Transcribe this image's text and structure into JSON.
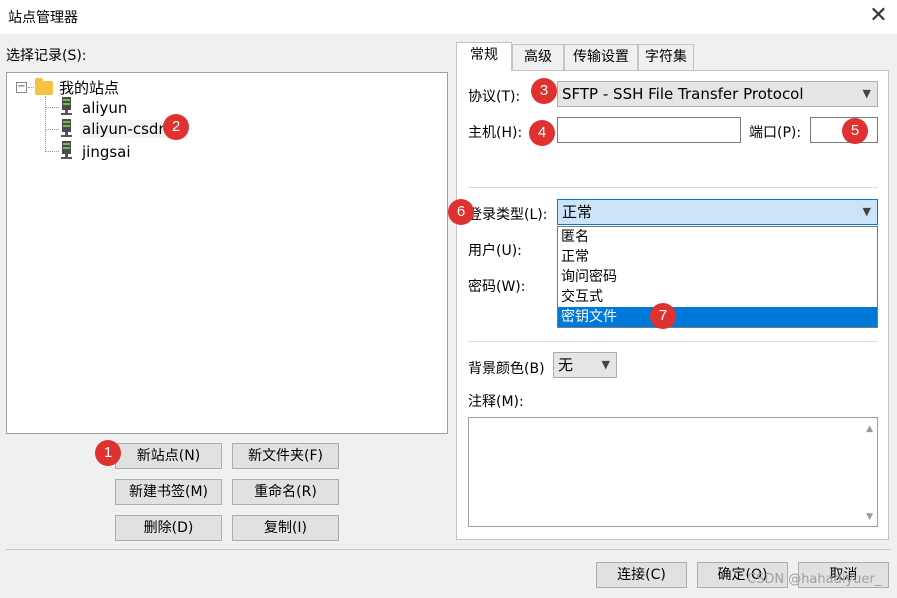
{
  "window": {
    "title": "站点管理器",
    "close_glyph": "✕"
  },
  "left": {
    "select_label": "选择记录(S):",
    "tree": {
      "root_label": "我的站点",
      "expander": "−",
      "sites": [
        "aliyun",
        "aliyun-csdn",
        "jingsai"
      ]
    },
    "buttons": {
      "new_site": "新站点(N)",
      "new_folder": "新文件夹(F)",
      "new_bookmark": "新建书签(M)",
      "rename": "重命名(R)",
      "delete": "删除(D)",
      "copy": "复制(I)"
    }
  },
  "tabs": [
    "常规",
    "高级",
    "传输设置",
    "字符集"
  ],
  "general": {
    "protocol_label": "协议(T):",
    "protocol_value": "SFTP - SSH File Transfer Protocol",
    "host_label": "主机(H):",
    "host_value": "",
    "port_label": "端口(P):",
    "port_value": "",
    "login_type_label": "登录类型(L):",
    "login_type_value": "正常",
    "login_type_options": [
      "匿名",
      "正常",
      "询问密码",
      "交互式",
      "密钥文件"
    ],
    "login_type_highlighted": "密钥文件",
    "user_label": "用户(U):",
    "password_label": "密码(W):",
    "bg_color_label": "背景颜色(B)",
    "bg_color_value": "无",
    "comment_label": "注释(M):",
    "comment_value": ""
  },
  "footer": {
    "connect": "连接(C)",
    "ok": "确定(O)",
    "cancel": "取消"
  },
  "annotations": [
    "1",
    "2",
    "3",
    "4",
    "5",
    "6",
    "7"
  ],
  "watermark": "CSDN @hahadiyuer_",
  "colors": {
    "badge": "#e03131",
    "highlight": "#0078d7",
    "focused_combo": "#cce4f7",
    "folder": "#f5c242"
  }
}
